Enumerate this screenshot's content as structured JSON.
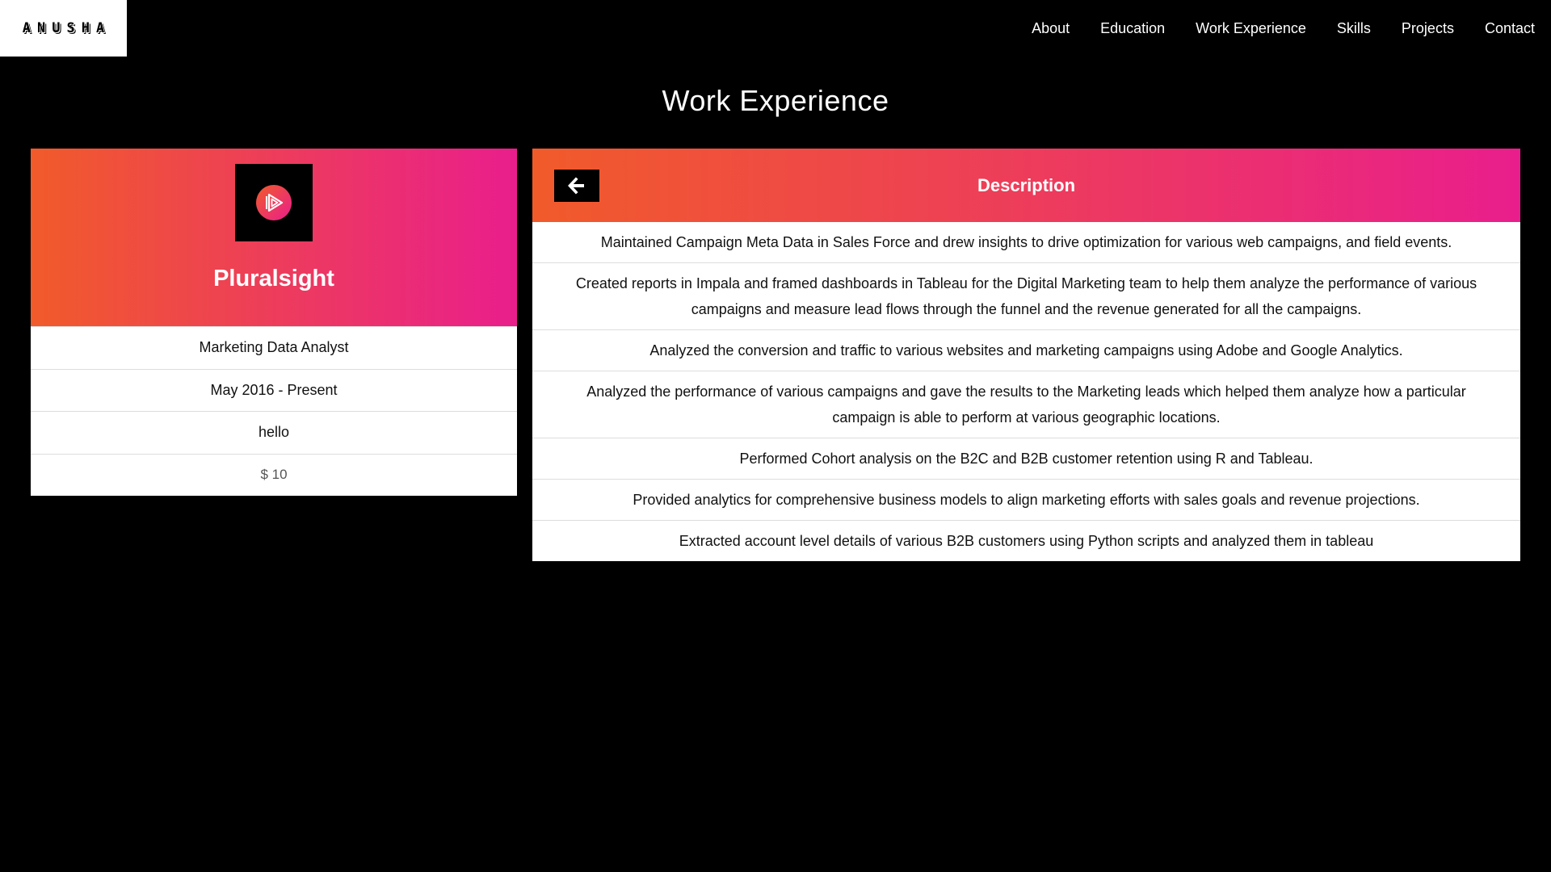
{
  "logo": {
    "text": "ANUSHA"
  },
  "nav": {
    "items": [
      "About",
      "Education",
      "Work Experience",
      "Skills",
      "Projects",
      "Contact"
    ]
  },
  "section": {
    "title": "Work Experience"
  },
  "company": {
    "name": "Pluralsight",
    "logo_icon": "pluralsight-play-icon",
    "role": "Marketing Data Analyst",
    "dates": "May 2016 - Present",
    "note": "hello",
    "price": "$ 10"
  },
  "description": {
    "title": "Description",
    "back_icon": "arrow-left-icon",
    "items": [
      "Maintained Campaign Meta Data in Sales Force and drew insights to drive optimization for various web campaigns, and field events.",
      "Created reports in Impala and framed dashboards in Tableau for the Digital Marketing team to help them analyze the performance of various campaigns and measure lead flows through the funnel and the revenue generated for all the campaigns.",
      "Analyzed the conversion and traffic to various websites and marketing campaigns using Adobe and Google Analytics.",
      "Analyzed the performance of various campaigns and gave the results to the Marketing leads which helped them analyze how a particular campaign is able to perform at various geographic locations.",
      "Performed Cohort analysis on the B2C and B2B customer retention using R and Tableau.",
      "Provided analytics for comprehensive business models to align marketing efforts with sales goals and revenue projections.",
      "Extracted account level details of various B2B customers using Python scripts and analyzed them in tableau"
    ]
  },
  "colors": {
    "background": "#000000",
    "gradient_start": "#f15b2a",
    "gradient_end": "#e91e8c",
    "card": "#ffffff"
  }
}
